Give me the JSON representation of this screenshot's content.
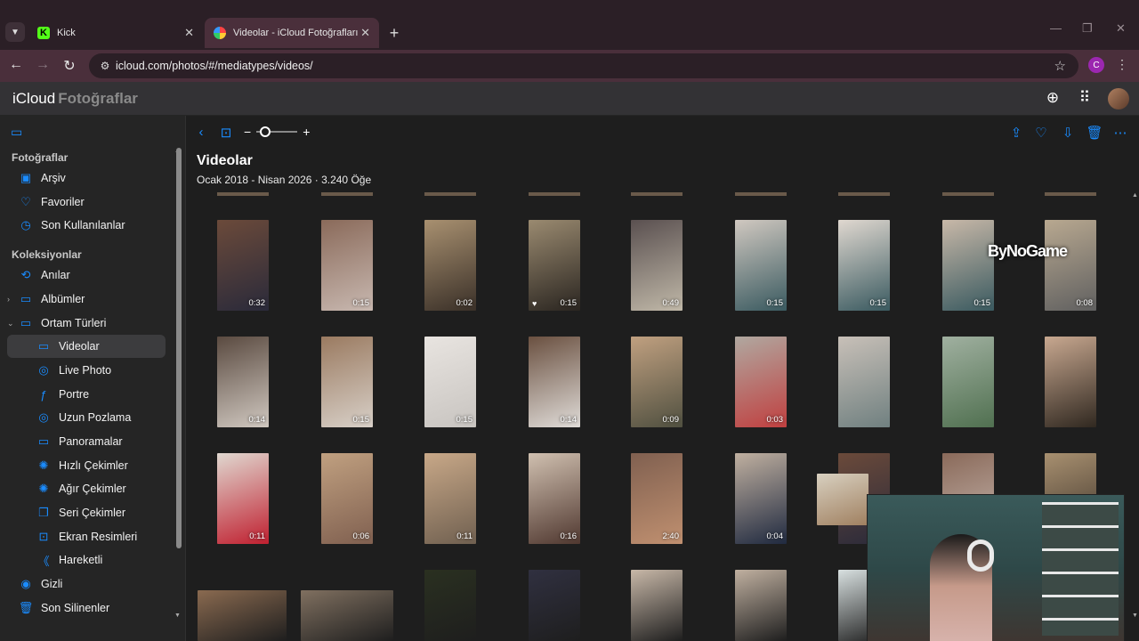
{
  "browser": {
    "tabs": [
      {
        "title": "Kick",
        "favicon": "K"
      },
      {
        "title": "Videolar - iCloud Fotoğrafları",
        "favicon": "photos-logo"
      }
    ],
    "url": "icloud.com/photos/#/mediatypes/videos/",
    "profile_initial": "C",
    "accent": "#1a8cff"
  },
  "app": {
    "logo_icloud": "iCloud",
    "logo_photos": "Fotoğraflar"
  },
  "sidebar": {
    "section_photos": "Fotoğraflar",
    "items_photos": [
      {
        "label": "Arşiv",
        "icon": "library-icon"
      },
      {
        "label": "Favoriler",
        "icon": "heart-icon"
      },
      {
        "label": "Son Kullanılanlar",
        "icon": "clock-icon"
      }
    ],
    "section_collections": "Koleksiyonlar",
    "items_collections": [
      {
        "label": "Anılar",
        "icon": "memories-icon"
      },
      {
        "label": "Albümler",
        "icon": "albums-icon"
      },
      {
        "label": "Ortam Türleri",
        "icon": "media-types-icon"
      },
      {
        "label": "Videolar",
        "icon": "video-icon"
      },
      {
        "label": "Live Photo",
        "icon": "live-photo-icon"
      },
      {
        "label": "Portre",
        "icon": "portrait-icon"
      },
      {
        "label": "Uzun Pozlama",
        "icon": "long-exposure-icon"
      },
      {
        "label": "Panoramalar",
        "icon": "panorama-icon"
      },
      {
        "label": "Hızlı Çekimler",
        "icon": "timelapse-icon"
      },
      {
        "label": "Ağır Çekimler",
        "icon": "slomo-icon"
      },
      {
        "label": "Seri Çekimler",
        "icon": "bursts-icon"
      },
      {
        "label": "Ekran Resimleri",
        "icon": "screenshot-icon"
      },
      {
        "label": "Hareketli",
        "icon": "animated-icon"
      },
      {
        "label": "Gizli",
        "icon": "hidden-icon"
      },
      {
        "label": "Son Silinenler",
        "icon": "trash-icon"
      }
    ]
  },
  "main": {
    "title": "Videolar",
    "subtitle": "Ocak 2018 - Nisan 2026 · 3.240 Öğe",
    "watermark": "ByNoGame",
    "rows": [
      [
        "0:32",
        "0:15",
        "0:02",
        "0:15",
        "0:49",
        "0:15",
        "0:15",
        "0:15",
        "0:08"
      ],
      [
        "0:14",
        "0:15",
        "0:15",
        "0:14",
        "0:09",
        "0:03",
        "",
        "",
        ""
      ],
      [
        "0:11",
        "0:06",
        "0:11",
        "0:16",
        "2:40",
        "0:04",
        "",
        "",
        ""
      ]
    ]
  }
}
